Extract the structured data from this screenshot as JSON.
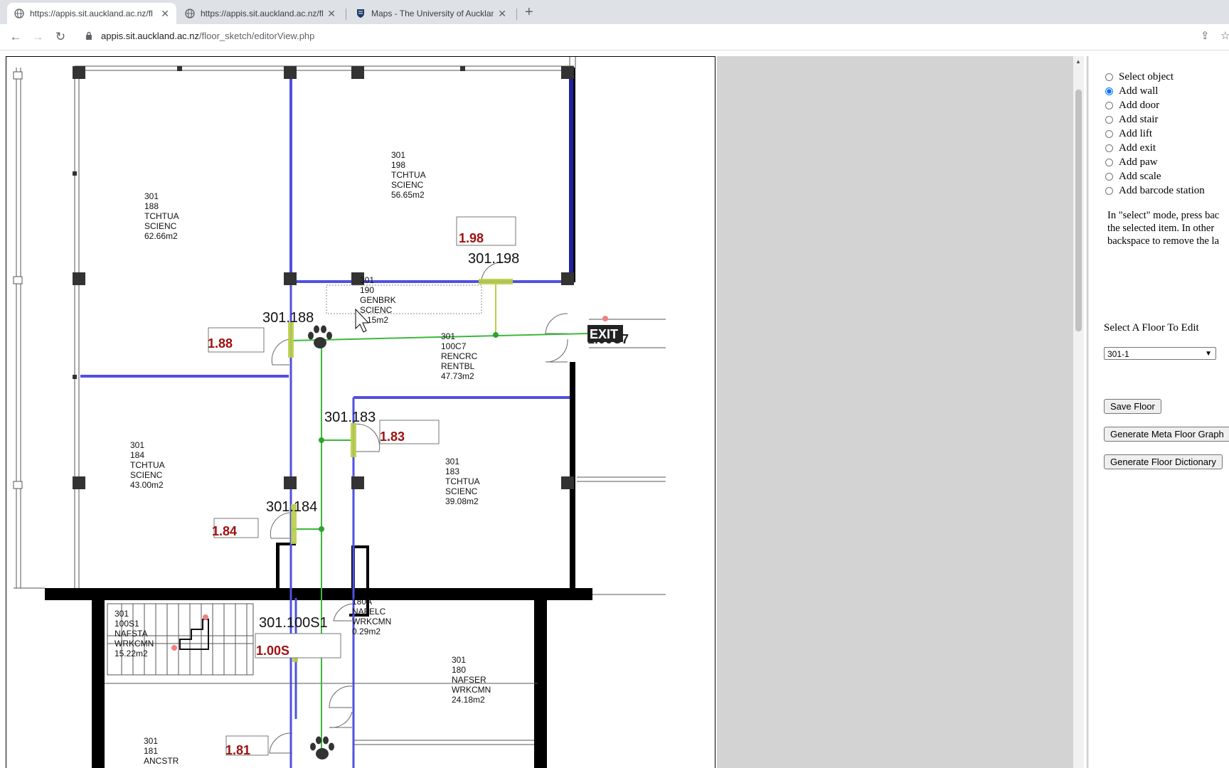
{
  "browser": {
    "tabs": [
      {
        "title": "https://appis.sit.auckland.ac.nz/fl",
        "active": true,
        "icon": "globe-icon"
      },
      {
        "title": "https://appis.sit.auckland.ac.nz/fl",
        "active": false,
        "icon": "globe-icon"
      },
      {
        "title": "Maps - The University of Auckland",
        "active": false,
        "icon": "shield-crest-icon"
      }
    ],
    "url_host": "appis.sit.auckland.ac.nz",
    "url_path": "/floor_sketch/editorView.php"
  },
  "floorplan": {
    "rooms": [
      {
        "lines": [
          "301",
          "188",
          "TCHTUA",
          "SCIENC",
          "62.66m2"
        ]
      },
      {
        "lines": [
          "301",
          "198",
          "TCHTUA",
          "SCIENC",
          "56.65m2"
        ]
      },
      {
        "lines": [
          "301",
          "190",
          "GENBRK",
          "SCIENC",
          "15m2"
        ]
      },
      {
        "lines": [
          "301",
          "100C7",
          "RENCRC",
          "RENTBL",
          "47.73m2"
        ]
      },
      {
        "lines": [
          "301",
          "184",
          "TCHTUA",
          "SCIENC",
          "43.00m2"
        ]
      },
      {
        "lines": [
          "301",
          "183",
          "TCHTUA",
          "SCIENC",
          "39.08m2"
        ]
      },
      {
        "lines": [
          "301",
          "100S1",
          "NAFSTA",
          "WRKCMN",
          "15.22m2"
        ]
      },
      {
        "lines": [
          "180A",
          "NAFELC",
          "WRKCMN",
          "0.29m2"
        ]
      },
      {
        "lines": [
          "301",
          "180",
          "NAFSER",
          "WRKCMN",
          "24.18m2"
        ]
      },
      {
        "lines": [
          "301",
          "181",
          "ANCSTR"
        ]
      }
    ],
    "door_labels": [
      "301.188",
      "301.198",
      "301.183",
      "301.184",
      "301.100S1"
    ],
    "door_boxes": [
      "1.88",
      "1.98",
      "1.83",
      "1.84",
      "1.00S",
      "1.81"
    ],
    "exit_label": "EXIT",
    "exit_room_id": "1.00C7",
    "colors": {
      "wall_blue": "#5050e0",
      "path_green": "#3cb83c",
      "door_yellow": "#b9cf46",
      "box_red": "#a01010"
    }
  },
  "panel": {
    "modes": [
      {
        "label": "Select object",
        "checked": false
      },
      {
        "label": "Add wall",
        "checked": true
      },
      {
        "label": "Add door",
        "checked": false
      },
      {
        "label": "Add stair",
        "checked": false
      },
      {
        "label": "Add lift",
        "checked": false
      },
      {
        "label": "Add exit",
        "checked": false
      },
      {
        "label": "Add paw",
        "checked": false
      },
      {
        "label": "Add scale",
        "checked": false
      },
      {
        "label": "Add barcode station",
        "checked": false
      }
    ],
    "help_lines": [
      "In \"select\" mode, press bac",
      "the selected item. In other",
      "backspace to remove the la"
    ],
    "floor_label": "Select A Floor To Edit",
    "floor_value": "301-1",
    "save_button": "Save Floor",
    "meta_button": "Generate Meta Floor Graph",
    "dict_button": "Generate Floor Dictionary"
  }
}
